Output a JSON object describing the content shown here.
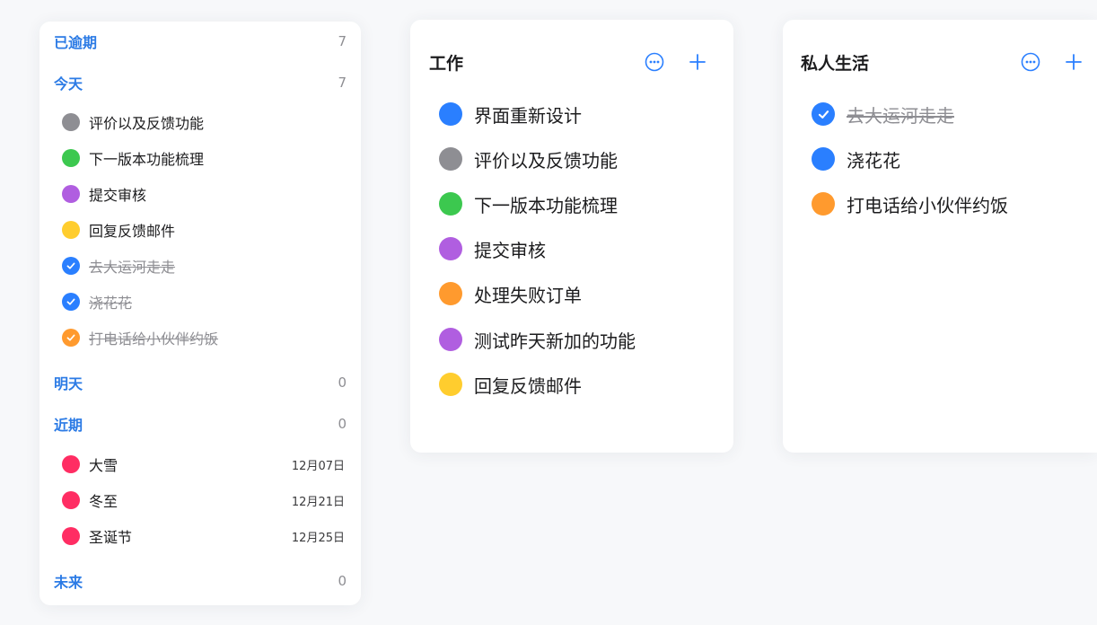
{
  "colors": {
    "blue": "#2a7fff",
    "gray": "#8e8e93",
    "green": "#3cc84f",
    "purple": "#b05ee0",
    "yellow": "#ffcd2e",
    "orange": "#ff9a2e",
    "red": "#ff2d63",
    "accent": "#2c7be5"
  },
  "sidebar": {
    "overdue": {
      "title": "已逾期",
      "count": "7"
    },
    "today": {
      "title": "今天",
      "count": "7",
      "items": [
        {
          "label": "评价以及反馈功能",
          "color": "gray",
          "done": false
        },
        {
          "label": "下一版本功能梳理",
          "color": "green",
          "done": false
        },
        {
          "label": "提交审核",
          "color": "purple",
          "done": false
        },
        {
          "label": "回复反馈邮件",
          "color": "yellow",
          "done": false
        },
        {
          "label": "去大运河走走",
          "color": "blue",
          "done": true
        },
        {
          "label": "浇花花",
          "color": "blue",
          "done": true
        },
        {
          "label": "打电话给小伙伴约饭",
          "color": "orange",
          "done": true
        }
      ]
    },
    "tomorrow": {
      "title": "明天",
      "count": "0"
    },
    "upcoming": {
      "title": "近期",
      "count": "0",
      "items": [
        {
          "label": "大雪",
          "date": "12月07日",
          "color": "red"
        },
        {
          "label": "冬至",
          "date": "12月21日",
          "color": "red"
        },
        {
          "label": "圣诞节",
          "date": "12月25日",
          "color": "red"
        }
      ]
    },
    "future": {
      "title": "未来",
      "count": "0"
    }
  },
  "work": {
    "title": "工作",
    "more_icon": "ellipsis-circle-icon",
    "add_icon": "plus-icon",
    "items": [
      {
        "label": "界面重新设计",
        "color": "blue",
        "done": false
      },
      {
        "label": "评价以及反馈功能",
        "color": "gray",
        "done": false
      },
      {
        "label": "下一版本功能梳理",
        "color": "green",
        "done": false
      },
      {
        "label": "提交审核",
        "color": "purple",
        "done": false
      },
      {
        "label": "处理失败订单",
        "color": "orange",
        "done": false
      },
      {
        "label": "测试昨天新加的功能",
        "color": "purple",
        "done": false
      },
      {
        "label": "回复反馈邮件",
        "color": "yellow",
        "done": false
      }
    ]
  },
  "life": {
    "title": "私人生活",
    "more_icon": "ellipsis-circle-icon",
    "add_icon": "plus-icon",
    "items": [
      {
        "label": "去大运河走走",
        "color": "blue",
        "done": true
      },
      {
        "label": "浇花花",
        "color": "blue",
        "done": false
      },
      {
        "label": "打电话给小伙伴约饭",
        "color": "orange",
        "done": false
      }
    ]
  }
}
